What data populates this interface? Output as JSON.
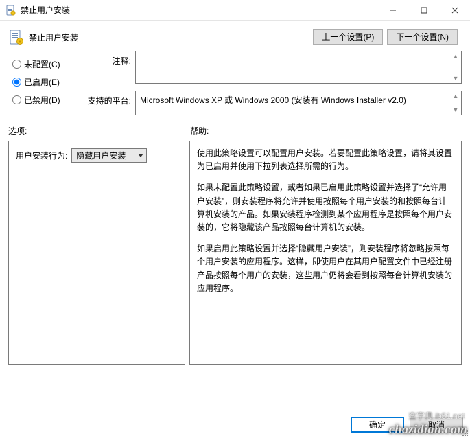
{
  "window": {
    "title": "禁止用户安装"
  },
  "header": {
    "policy_title": "禁止用户安装",
    "prev_setting": "上一个设置(P)",
    "next_setting": "下一个设置(N)"
  },
  "radios": {
    "not_configured": "未配置(C)",
    "enabled": "已启用(E)",
    "disabled": "已禁用(D)",
    "selected": "enabled"
  },
  "fields": {
    "comment_label": "注释:",
    "comment_value": "",
    "platform_label": "支持的平台:",
    "platform_value": "Microsoft Windows XP 或 Windows 2000 (安装有 Windows Installer v2.0)"
  },
  "section": {
    "options_label": "选项:",
    "help_label": "帮助:"
  },
  "option": {
    "label": "用户安装行为:",
    "dropdown_value": "隐藏用户安装"
  },
  "help": {
    "p1": "使用此策略设置可以配置用户安装。若要配置此策略设置，请将其设置为已启用并使用下拉列表选择所需的行为。",
    "p2": "如果未配置此策略设置，或者如果已启用此策略设置并选择了“允许用户安装”，则安装程序将允许并使用按照每个用户安装的和按照每台计算机安装的产品。如果安装程序检测到某个应用程序是按照每个用户安装的，它将隐藏该产品按照每台计算机的安装。",
    "p3": "如果启用此策略设置并选择“隐藏用户安装”，则安装程序将忽略按照每个用户安装的应用程序。这样，即使用户在其用户配置文件中已经注册产品按照每个用户的安装，这些用户仍将会看到按照每台计算机安装的应用程序。"
  },
  "buttons": {
    "ok": "确定",
    "cancel": "取消"
  },
  "watermark": {
    "site": "chazidian.com",
    "extra": "查字典 ib51.net"
  }
}
